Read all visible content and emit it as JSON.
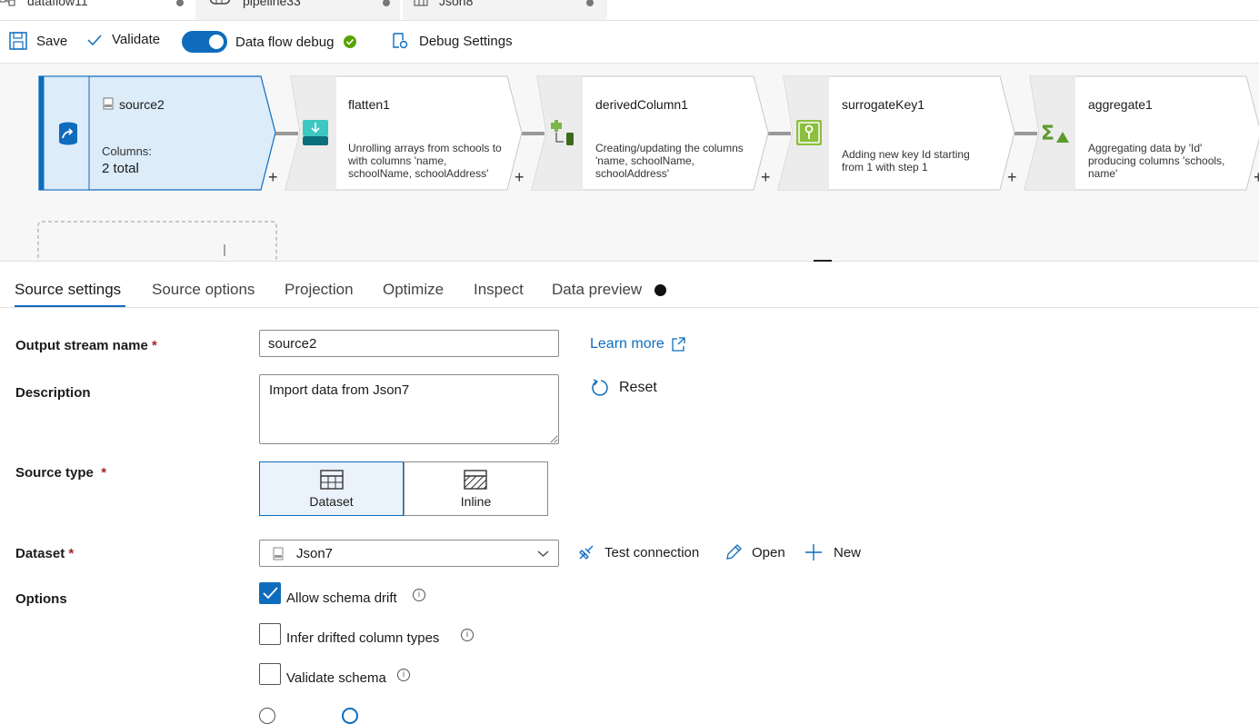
{
  "tabs": [
    {
      "label": "dataflow11",
      "icon": "dataflow-icon"
    },
    {
      "label": "pipeline33",
      "icon": "pipeline-icon"
    },
    {
      "label": "Json8",
      "icon": "table-icon"
    }
  ],
  "toolbar": {
    "save": "Save",
    "validate": "Validate",
    "debug_label": "Data flow debug",
    "debug_on": true,
    "debug_settings": "Debug Settings"
  },
  "nodes": [
    {
      "title": "source2",
      "desc_label": "Columns:",
      "desc_value": "2 total",
      "icon": "source-icon"
    },
    {
      "title": "flatten1",
      "desc": "Unrolling arrays from schools to  with columns 'name, schoolName, schoolAddress'",
      "icon": "flatten-icon"
    },
    {
      "title": "derivedColumn1",
      "desc": "Creating/updating the columns 'name, schoolName, schoolAddress'",
      "icon": "derived-column-icon"
    },
    {
      "title": "surrogateKey1",
      "desc": "Adding new key Id starting from 1 with step 1",
      "icon": "key-icon"
    },
    {
      "title": "aggregate1",
      "desc": "Aggregating data by 'Id' producing columns 'schools, name'",
      "icon": "aggregate-icon"
    }
  ],
  "settings_tabs": [
    "Source settings",
    "Source options",
    "Projection",
    "Optimize",
    "Inspect",
    "Data preview"
  ],
  "form": {
    "output_stream_label": "Output stream name",
    "output_stream_value": "source2",
    "learn_more": "Learn more",
    "description_label": "Description",
    "description_value": "Import data from Json7",
    "reset": "Reset",
    "source_type_label": "Source type",
    "source_type_options": [
      "Dataset",
      "Inline"
    ],
    "source_type_selected": "Dataset",
    "dataset_label": "Dataset",
    "dataset_value": "Json7",
    "test_connection": "Test connection",
    "open": "Open",
    "new": "New",
    "options_label": "Options",
    "options": [
      {
        "label": "Allow schema drift",
        "checked": true
      },
      {
        "label": "Infer drifted column types",
        "checked": false
      },
      {
        "label": "Validate schema",
        "checked": false
      }
    ]
  },
  "colors": {
    "accent": "#0f6cbd",
    "debug_ok": "#57a300",
    "node_selected_bg": "#dcecf9"
  }
}
